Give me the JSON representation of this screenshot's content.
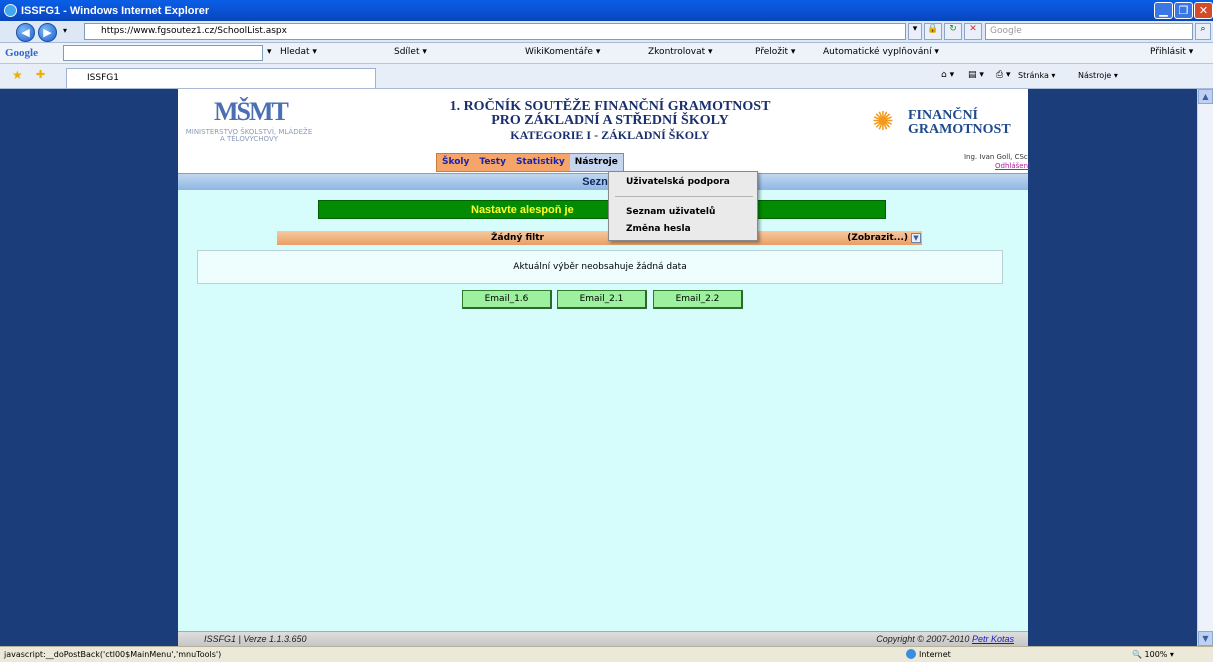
{
  "browser": {
    "title": "ISSFG1 - Windows Internet Explorer",
    "url": "https://www.fgsoutez1.cz/SchoolList.aspx",
    "search_placeholder": "Google",
    "tab_label": "ISSFG1",
    "status_text": "javascript:__doPostBack('ctl00$MainMenu','mnuTools')",
    "zone": "Internet",
    "zoom": "100%"
  },
  "google_toolbar": {
    "logo": "Google",
    "items": [
      "Hledat ▾",
      "Sdílet ▾",
      "WikiKomentáře ▾",
      "Zkontrolovat ▾",
      "Přeložit ▾",
      "Automatické vyplňování ▾"
    ],
    "signin": "Přihlásit ▾"
  },
  "ie_toolbar": {
    "page": "Stránka ▾",
    "tools": "Nástroje ▾"
  },
  "header": {
    "logo_mark": "MŠMT",
    "logo_sub": "MINISTERSTVO ŠKOLSTVÍ, MLÁDEŽE A TĚLOVÝCHOVY",
    "title_line1": "1. ROČNÍK SOUTĚŽE FINANČNÍ GRAMOTNOST",
    "title_line2": "PRO ZÁKLADNÍ A STŘEDNÍ ŠKOLY",
    "title_line3": "KATEGORIE I - ZÁKLADNÍ ŠKOLY",
    "brand_line1": "FINANČNÍ",
    "brand_line2": "GRAMOTNOST"
  },
  "menu": {
    "items": [
      "Školy",
      "Testy",
      "Statistiky",
      "Nástroje"
    ],
    "active": "Nástroje",
    "dropdown": [
      "Uživatelská podpora",
      "Seznam uživatelů",
      "Změna hesla"
    ]
  },
  "user": {
    "name": "Ing. Ivan Goll, CSc.",
    "logout": "Odhlášení"
  },
  "main": {
    "section_title": "Seznam",
    "notice": "Nastavte alespoň je",
    "filter_label": "Žádný filtr",
    "filter_toggle": "(Zobrazit...)",
    "empty_message": "Aktuální výběr neobsahuje žádná data",
    "buttons": [
      "Email_1.6",
      "Email_2.1",
      "Email_2.2"
    ]
  },
  "footer": {
    "version": "ISSFG1 | Verze 1.1.3.650",
    "copyright": "Copyright © 2007-2010",
    "author": "Petr Kotas"
  }
}
